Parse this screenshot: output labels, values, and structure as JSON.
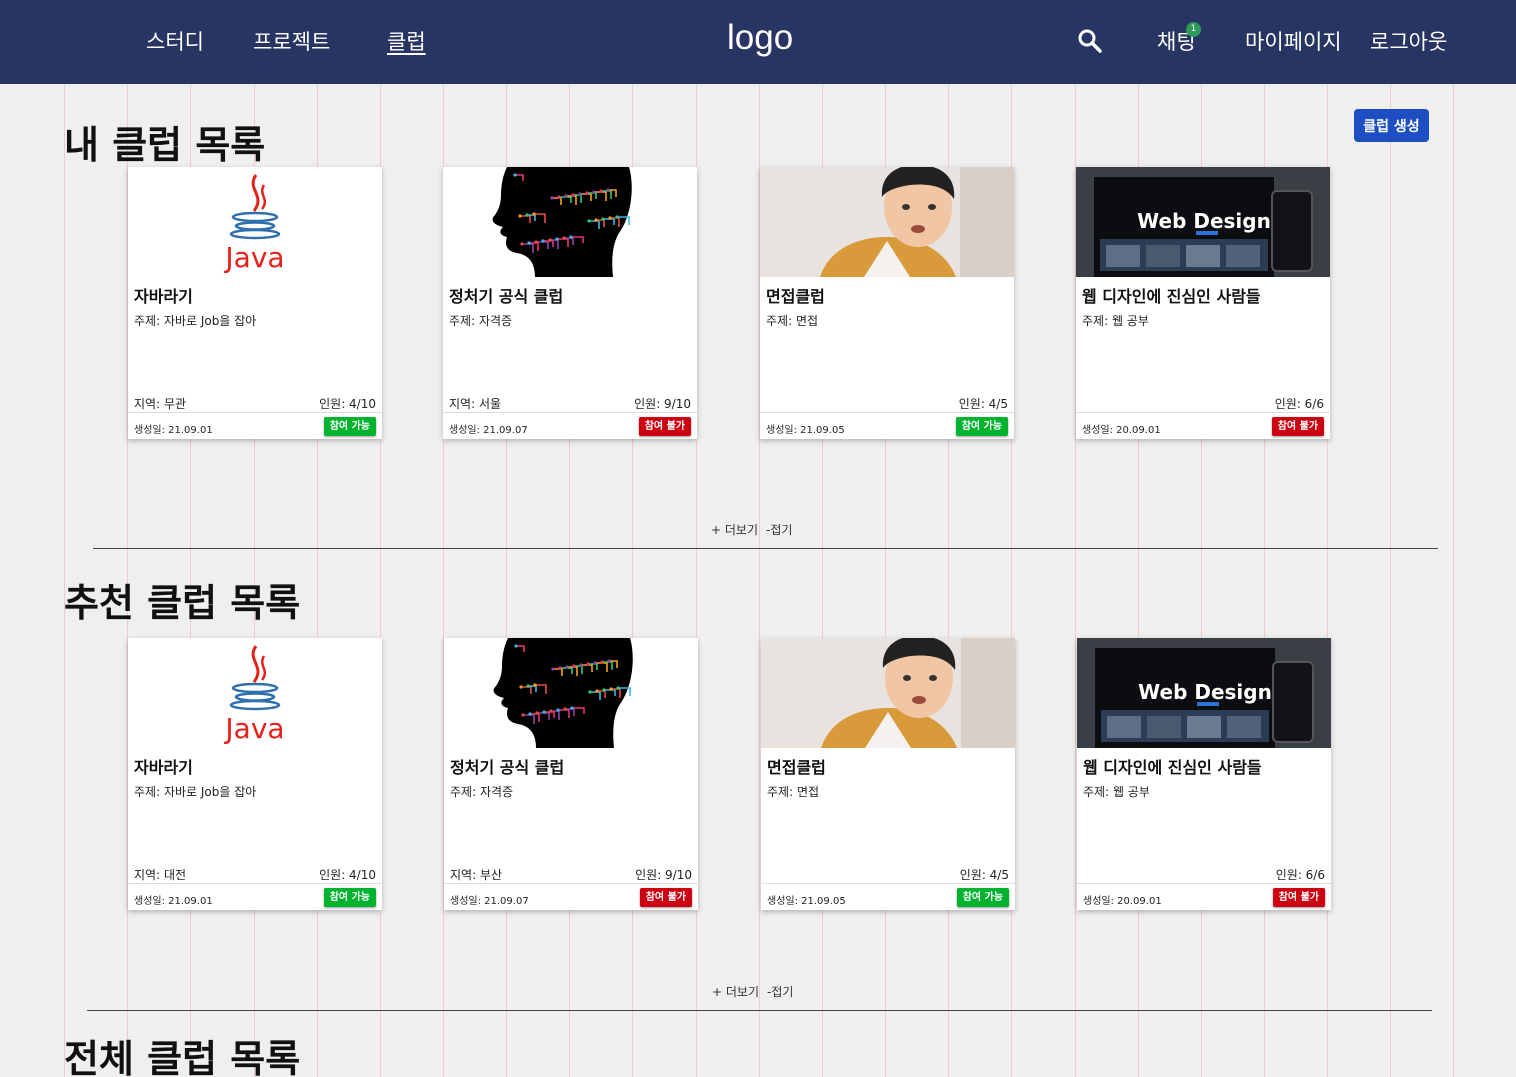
{
  "header": {
    "nav": [
      "스터디",
      "프로젝트",
      "클럽"
    ],
    "logo": "logo",
    "right": [
      "채팅",
      "마이페이지",
      "로그아웃"
    ],
    "chat_badge": "1",
    "bg_color": "#283562"
  },
  "colors": {
    "available": "#00b32e",
    "unavailable": "#cc0011",
    "primary_button": "#1d4fc2"
  },
  "my_clubs": {
    "title": "내 클럽 목록",
    "create_button": "클럽 생성",
    "more": "+ 더보기",
    "fold": "-접기",
    "cards": [
      {
        "image": "java-logo",
        "java_text": "Java",
        "title": "자바라기",
        "topic": "주제: 자바로 Job을 잡아",
        "region": "지역: 무관",
        "members": "인원: 4/10",
        "date": "생성일: 21.09.01",
        "status": "참여 가능",
        "available": true
      },
      {
        "image": "circuit-brain-head",
        "title": "정처기 공식 클럽",
        "topic": "주제: 자격증",
        "region": "지역: 서울",
        "members": "인원: 9/10",
        "date": "생성일: 21.09.07",
        "status": "참여 불가",
        "available": false
      },
      {
        "image": "person-photo",
        "title": "면접클럽",
        "topic": "주제: 면접",
        "region": "",
        "members": "인원: 4/5",
        "date": "생성일: 21.09.05",
        "status": "참여 가능",
        "available": true
      },
      {
        "image": "web-design-banner",
        "banner_text": "Web Design",
        "title": "웹 디자인에 진심인 사람들",
        "topic": "주제: 웹 공부",
        "region": "",
        "members": "인원: 6/6",
        "date": "생성일: 20.09.01",
        "status": "참여 불가",
        "available": false
      }
    ]
  },
  "recommended_clubs": {
    "title": "추천 클럽 목록",
    "more": "+ 더보기",
    "fold": "-접기",
    "cards": [
      {
        "image": "java-logo",
        "java_text": "Java",
        "title": "자바라기",
        "topic": "주제: 자바로 Job을 잡아",
        "region": "지역: 대전",
        "members": "인원: 4/10",
        "date": "생성일: 21.09.01",
        "status": "참여 가능",
        "available": true
      },
      {
        "image": "circuit-brain-head",
        "title": "정처기 공식 클럽",
        "topic": "주제: 자격증",
        "region": "지역: 부산",
        "members": "인원: 9/10",
        "date": "생성일: 21.09.07",
        "status": "참여 불가",
        "available": false
      },
      {
        "image": "person-photo",
        "title": "면접클럽",
        "topic": "주제: 면접",
        "region": "",
        "members": "인원: 4/5",
        "date": "생성일: 21.09.05",
        "status": "참여 가능",
        "available": true
      },
      {
        "image": "web-design-banner",
        "banner_text": "Web Design",
        "title": "웹 디자인에 진심인 사람들",
        "topic": "주제: 웹 공부",
        "region": "",
        "members": "인원: 6/6",
        "date": "생성일: 20.09.01",
        "status": "참여 불가",
        "available": false
      }
    ]
  },
  "all_clubs": {
    "title": "전체 클럽 목록"
  }
}
